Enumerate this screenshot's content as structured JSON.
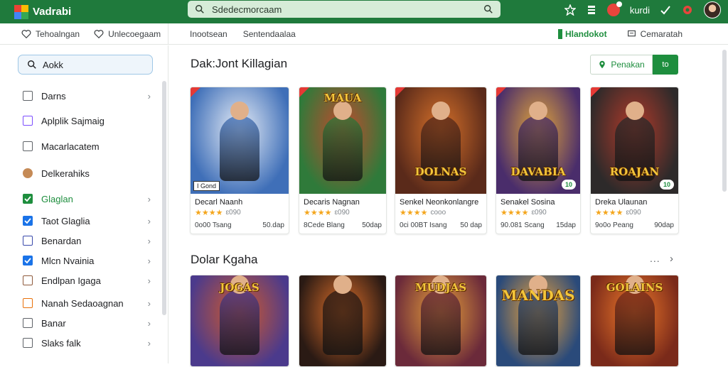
{
  "app": {
    "name": "Vadrabi"
  },
  "top_search": {
    "value": "Sdedecmorcaam"
  },
  "top_actions": {
    "label": "kurdi"
  },
  "subbar": {
    "left": [
      "Tehoalngan",
      "Unlecoegaam"
    ],
    "mid": [
      "Inootsean",
      "Sentendaalaa"
    ],
    "right": [
      "Hlandokot",
      "Cemaratah"
    ]
  },
  "sidebar": {
    "search_value": "Aokk",
    "items": [
      {
        "label": "Darns",
        "color": "#5f6368",
        "chev": true
      },
      {
        "label": "Aplplik Sajmaig",
        "color": "#7c4dff",
        "chev": false
      },
      {
        "label": "Macarlacatem",
        "color": "#5f6368",
        "chev": false
      },
      {
        "label": "Delkerahiks",
        "color": "#c58a56",
        "chev": false
      },
      {
        "label": "Glaglan",
        "color": "#1e8e3e",
        "chev": true,
        "active": true
      },
      {
        "label": "Taot Glaglia",
        "color": "#1a73e8",
        "chev": true
      },
      {
        "label": "Benardan",
        "color": "#3949ab",
        "chev": true
      },
      {
        "label": "Mlcn Nvainia",
        "color": "#1a73e8",
        "chev": true
      },
      {
        "label": "Endlpan Igaga",
        "color": "#8e5a3c",
        "chev": true
      },
      {
        "label": "Nanah Sedaoagnan",
        "color": "#e8710a",
        "chev": true
      },
      {
        "label": "Banar",
        "color": "#5f6368",
        "chev": true
      },
      {
        "label": "Slaks falk",
        "color": "#5f6368",
        "chev": true
      }
    ]
  },
  "section1": {
    "title": "Dak:Jont Killagian",
    "filter_label": "Penakan",
    "filter_go": "to",
    "cards": [
      {
        "name": "Decarl Naanh",
        "stars": "★★★★",
        "reviews": "ɛ090",
        "meta_left": "0o00 Tsang",
        "meta_right": "50.dap",
        "art": [
          "#3f6fb8",
          "#e8eef7"
        ],
        "caption": "",
        "tag": "I Gond",
        "badge": ""
      },
      {
        "name": "Decaris Nagnan",
        "stars": "★★★★",
        "reviews": "ɛ090",
        "meta_left": "8Cede Blang",
        "meta_right": "50dap",
        "art": [
          "#2f7a3a",
          "#c4492d"
        ],
        "caption": "MAUA",
        "tag": "",
        "badge": ""
      },
      {
        "name": "Senkel Neonkonlangre",
        "stars": "★★★★",
        "reviews": "cooo",
        "meta_left": "0ci 00BT Isang",
        "meta_right": "50 dap",
        "art": [
          "#5a2a1a",
          "#d7712a"
        ],
        "caption": "DOLNAS",
        "tag": "",
        "badge": ""
      },
      {
        "name": "Senakel Sosina",
        "stars": "★★★★",
        "reviews": "ɛ090",
        "meta_left": "90.081 Scang",
        "meta_right": "15dap",
        "art": [
          "#4a2d6b",
          "#e3a63a"
        ],
        "caption": "DAVABIA",
        "tag": "",
        "badge": "10"
      },
      {
        "name": "Dreka Ulaunan",
        "stars": "★★★★",
        "reviews": "ɛ090",
        "meta_left": "9o0o Peang",
        "meta_right": "90dap",
        "art": [
          "#2d2a2a",
          "#b33a2a"
        ],
        "caption": "ROAJAN",
        "tag": "",
        "badge": "10"
      }
    ]
  },
  "section2": {
    "title": "Dolar Kgaha",
    "more": "...",
    "cards": [
      {
        "art": [
          "#4b3a8c",
          "#d35a2a"
        ],
        "caption": "JOGAS"
      },
      {
        "art": [
          "#2a1a14",
          "#e0702a"
        ],
        "caption": ""
      },
      {
        "art": [
          "#6b2a3a",
          "#e9a13a"
        ],
        "caption": "MUDJAS"
      },
      {
        "art": [
          "#2a4a7a",
          "#f2a63a"
        ],
        "caption": "MANDAS"
      },
      {
        "art": [
          "#7a2a1a",
          "#f07a2a"
        ],
        "caption": "GOLAINS"
      }
    ]
  }
}
